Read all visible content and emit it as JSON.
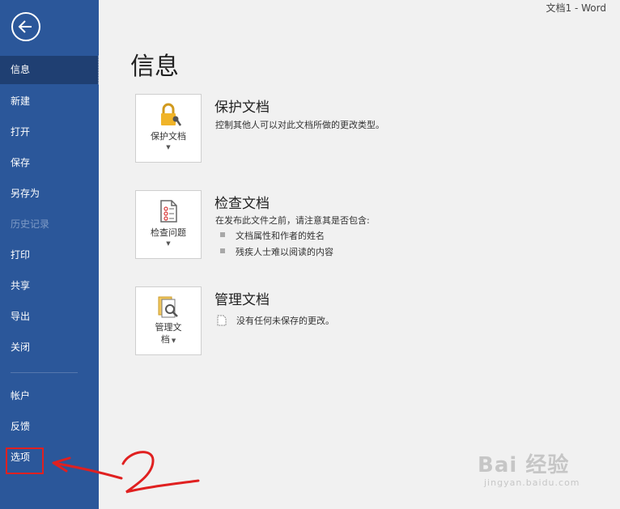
{
  "window": {
    "title": "文档1  -  Word"
  },
  "sidebar": {
    "back_icon": "back-arrow-icon",
    "items": [
      {
        "label": "信息",
        "state": "active"
      },
      {
        "label": "新建",
        "state": "normal"
      },
      {
        "label": "打开",
        "state": "normal"
      },
      {
        "label": "保存",
        "state": "normal"
      },
      {
        "label": "另存为",
        "state": "normal"
      },
      {
        "label": "历史记录",
        "state": "disabled"
      },
      {
        "label": "打印",
        "state": "normal"
      },
      {
        "label": "共享",
        "state": "normal"
      },
      {
        "label": "导出",
        "state": "normal"
      },
      {
        "label": "关闭",
        "state": "normal"
      },
      {
        "label": "帐户",
        "state": "normal"
      },
      {
        "label": "反馈",
        "state": "normal"
      },
      {
        "label": "选项",
        "state": "normal"
      }
    ]
  },
  "main": {
    "title": "信息",
    "sections": [
      {
        "button_label": "保护文档",
        "icon": "lock-key-icon",
        "title": "保护文档",
        "description": "控制其他人可以对此文档所做的更改类型。"
      },
      {
        "button_label": "检查问题",
        "icon": "checklist-document-icon",
        "title": "检查文档",
        "description": "在发布此文件之前，请注意其是否包含:",
        "bullets": [
          "文档属性和作者的姓名",
          "残疾人士难以阅读的内容"
        ]
      },
      {
        "button_label_lines": [
          "管理文",
          "档"
        ],
        "icon": "document-search-icon",
        "title": "管理文档",
        "status": "没有任何未保存的更改。"
      }
    ]
  },
  "annotation": {
    "number": "2",
    "color": "#e02020"
  },
  "watermark": {
    "main": "Bai 经验",
    "sub": "jingyan.baidu.com"
  },
  "colors": {
    "sidebar": "#2b579a",
    "sidebar_active": "#1f3f72",
    "background": "#f1f1f1",
    "annotation": "#e02020"
  }
}
